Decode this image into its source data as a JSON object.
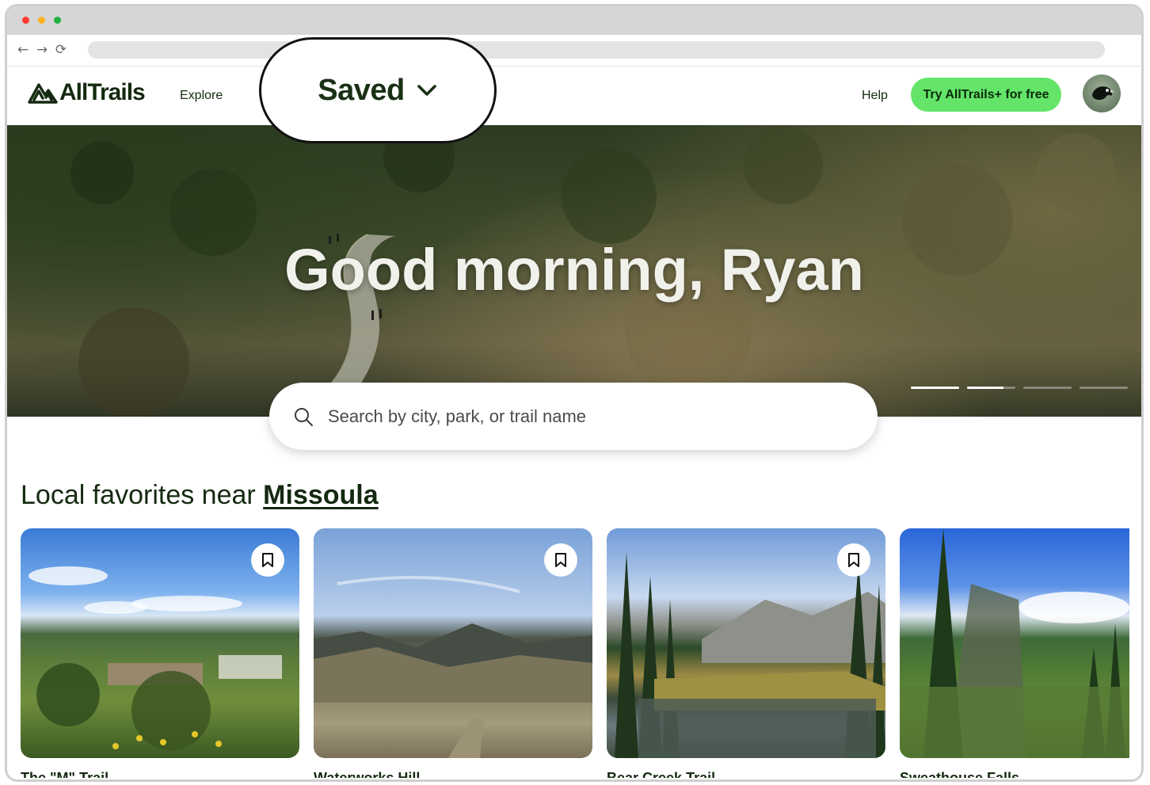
{
  "browser": {
    "back_icon": "←",
    "forward_icon": "→",
    "reload_icon": "⟳"
  },
  "header": {
    "logo": "AllTrails",
    "nav_explore": "Explore",
    "nav_help": "Help",
    "cta_label": "Try AllTrails+ for free",
    "saved_label": "Saved"
  },
  "hero": {
    "greeting": "Good morning, Ryan",
    "carousel": [
      1,
      0.75,
      0,
      0
    ]
  },
  "search": {
    "placeholder": "Search by city, park, or trail name"
  },
  "section": {
    "prefix": "Local favorites near ",
    "location": "Missoula"
  },
  "cards": [
    {
      "name": "The \"M\" Trail"
    },
    {
      "name": "Waterworks Hill"
    },
    {
      "name": "Bear Creek Trail"
    },
    {
      "name": "Sweathouse Falls"
    }
  ],
  "colors": {
    "brand_dark": "#142a10",
    "cta_green": "#64e56a"
  }
}
